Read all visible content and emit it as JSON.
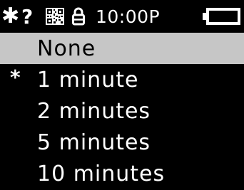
{
  "status_bar": {
    "bluetooth_icon": "bluetooth-icon",
    "bluetooth_status": "?",
    "qr_icon": "qr-code-icon",
    "lock_icon": "lock-icon",
    "time": "10:00P",
    "battery_icon": "battery-icon"
  },
  "menu": {
    "items": [
      {
        "label": "None",
        "mark": "",
        "selected": true
      },
      {
        "label": "1 minute",
        "mark": "*",
        "selected": false
      },
      {
        "label": "2 minutes",
        "mark": "",
        "selected": false
      },
      {
        "label": "5 minutes",
        "mark": "",
        "selected": false
      },
      {
        "label": "10 minutes",
        "mark": "",
        "selected": false
      }
    ]
  },
  "colors": {
    "background": "#000000",
    "foreground": "#ffffff",
    "highlight": "#c6c6c6"
  }
}
